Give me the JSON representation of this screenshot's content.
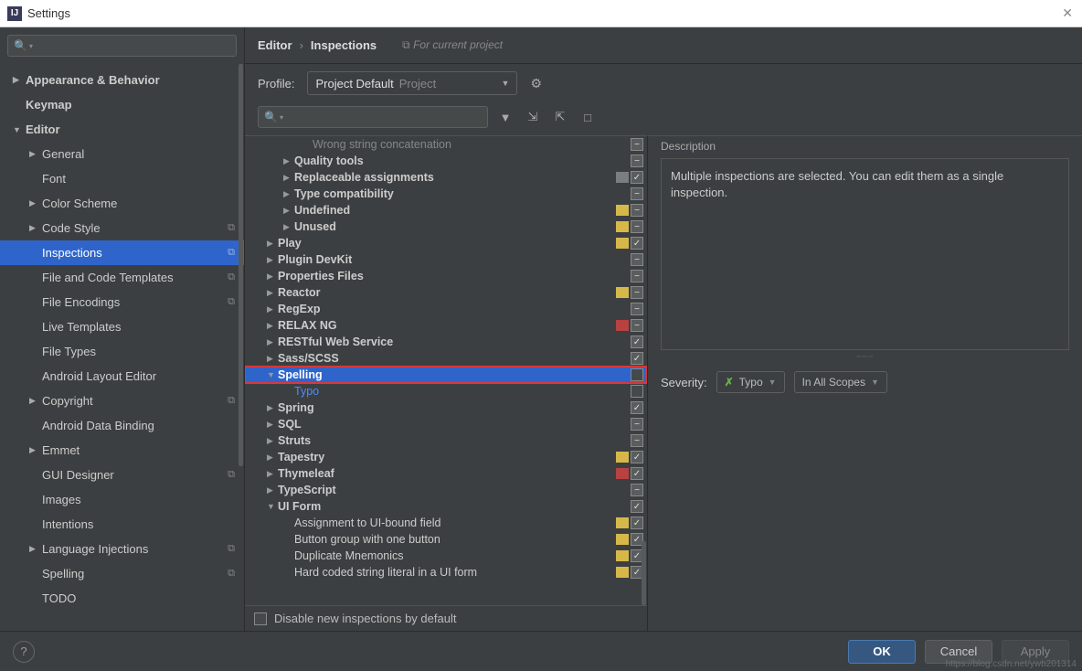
{
  "window": {
    "title": "Settings"
  },
  "breadcrumb": {
    "a": "Editor",
    "b": "Inspections",
    "proj": "For current project"
  },
  "profile": {
    "label": "Profile:",
    "value": "Project Default",
    "secondary": "Project"
  },
  "sidebar": [
    {
      "label": "Appearance & Behavior",
      "arrow": "▶",
      "bold": true,
      "ind": 0
    },
    {
      "label": "Keymap",
      "arrow": "",
      "bold": true,
      "ind": 0
    },
    {
      "label": "Editor",
      "arrow": "▼",
      "bold": true,
      "ind": 0
    },
    {
      "label": "General",
      "arrow": "▶",
      "ind": 1
    },
    {
      "label": "Font",
      "arrow": "",
      "ind": 1
    },
    {
      "label": "Color Scheme",
      "arrow": "▶",
      "ind": 1
    },
    {
      "label": "Code Style",
      "arrow": "▶",
      "ind": 1,
      "copy": true
    },
    {
      "label": "Inspections",
      "arrow": "",
      "ind": 1,
      "selected": true,
      "copy": true
    },
    {
      "label": "File and Code Templates",
      "arrow": "",
      "ind": 1,
      "copy": true
    },
    {
      "label": "File Encodings",
      "arrow": "",
      "ind": 1,
      "copy": true
    },
    {
      "label": "Live Templates",
      "arrow": "",
      "ind": 1
    },
    {
      "label": "File Types",
      "arrow": "",
      "ind": 1
    },
    {
      "label": "Android Layout Editor",
      "arrow": "",
      "ind": 1
    },
    {
      "label": "Copyright",
      "arrow": "▶",
      "ind": 1,
      "copy": true
    },
    {
      "label": "Android Data Binding",
      "arrow": "",
      "ind": 1
    },
    {
      "label": "Emmet",
      "arrow": "▶",
      "ind": 1
    },
    {
      "label": "GUI Designer",
      "arrow": "",
      "ind": 1,
      "copy": true
    },
    {
      "label": "Images",
      "arrow": "",
      "ind": 1
    },
    {
      "label": "Intentions",
      "arrow": "",
      "ind": 1
    },
    {
      "label": "Language Injections",
      "arrow": "▶",
      "ind": 1,
      "copy": true
    },
    {
      "label": "Spelling",
      "arrow": "",
      "ind": 1,
      "copy": true
    },
    {
      "label": "TODO",
      "arrow": "",
      "ind": 1
    }
  ],
  "inspections": [
    {
      "label": "Wrong string concatenation",
      "ind": 3,
      "status": "",
      "chk": "mixed",
      "dim": true
    },
    {
      "label": "Quality tools",
      "ind": 2,
      "arrow": "▶",
      "bold": true,
      "chk": "mixed"
    },
    {
      "label": "Replaceable assignments",
      "ind": 2,
      "arrow": "▶",
      "bold": true,
      "status": "gray",
      "chk": "checked"
    },
    {
      "label": "Type compatibility",
      "ind": 2,
      "arrow": "▶",
      "bold": true,
      "chk": "mixed"
    },
    {
      "label": "Undefined",
      "ind": 2,
      "arrow": "▶",
      "bold": true,
      "status": "yellow",
      "chk": "mixed"
    },
    {
      "label": "Unused",
      "ind": 2,
      "arrow": "▶",
      "bold": true,
      "status": "yellow",
      "chk": "mixed"
    },
    {
      "label": "Play",
      "ind": 1,
      "arrow": "▶",
      "bold": true,
      "status": "yellow",
      "chk": "checked"
    },
    {
      "label": "Plugin DevKit",
      "ind": 1,
      "arrow": "▶",
      "bold": true,
      "chk": "mixed"
    },
    {
      "label": "Properties Files",
      "ind": 1,
      "arrow": "▶",
      "bold": true,
      "chk": "mixed"
    },
    {
      "label": "Reactor",
      "ind": 1,
      "arrow": "▶",
      "bold": true,
      "status": "yellow",
      "chk": "mixed"
    },
    {
      "label": "RegExp",
      "ind": 1,
      "arrow": "▶",
      "bold": true,
      "chk": "mixed"
    },
    {
      "label": "RELAX NG",
      "ind": 1,
      "arrow": "▶",
      "bold": true,
      "status": "red",
      "chk": "mixed"
    },
    {
      "label": "RESTful Web Service",
      "ind": 1,
      "arrow": "▶",
      "bold": true,
      "chk": "checked"
    },
    {
      "label": "Sass/SCSS",
      "ind": 1,
      "arrow": "▶",
      "bold": true,
      "chk": "checked"
    },
    {
      "label": "Spelling",
      "ind": 1,
      "arrow": "▼",
      "bold": true,
      "selected": true,
      "highlighted": true,
      "chk": "empty"
    },
    {
      "label": "Typo",
      "ind": 2,
      "subsel": true,
      "chk": "empty"
    },
    {
      "label": "Spring",
      "ind": 1,
      "arrow": "▶",
      "bold": true,
      "chk": "checked"
    },
    {
      "label": "SQL",
      "ind": 1,
      "arrow": "▶",
      "bold": true,
      "chk": "mixed"
    },
    {
      "label": "Struts",
      "ind": 1,
      "arrow": "▶",
      "bold": true,
      "chk": "mixed"
    },
    {
      "label": "Tapestry",
      "ind": 1,
      "arrow": "▶",
      "bold": true,
      "status": "yellow",
      "chk": "checked"
    },
    {
      "label": "Thymeleaf",
      "ind": 1,
      "arrow": "▶",
      "bold": true,
      "status": "red",
      "chk": "checked"
    },
    {
      "label": "TypeScript",
      "ind": 1,
      "arrow": "▶",
      "bold": true,
      "chk": "mixed"
    },
    {
      "label": "UI Form",
      "ind": 1,
      "arrow": "▼",
      "bold": true,
      "chk": "checked"
    },
    {
      "label": "Assignment to UI-bound field",
      "ind": 2,
      "status": "yellow",
      "chk": "checked"
    },
    {
      "label": "Button group with one button",
      "ind": 2,
      "status": "yellow",
      "chk": "checked"
    },
    {
      "label": "Duplicate Mnemonics",
      "ind": 2,
      "status": "yellow",
      "chk": "checked"
    },
    {
      "label": "Hard coded string literal in a UI form",
      "ind": 2,
      "status": "yellow",
      "chk": "checked"
    }
  ],
  "disable_new": "Disable new inspections by default",
  "description": {
    "label": "Description",
    "text": "Multiple inspections are selected. You can edit them as a single inspection."
  },
  "severity": {
    "label": "Severity:",
    "value": "Typo",
    "scope": "In All Scopes"
  },
  "buttons": {
    "ok": "OK",
    "cancel": "Cancel",
    "apply": "Apply"
  },
  "watermark": "https://blog.csdn.net/ywb201314"
}
